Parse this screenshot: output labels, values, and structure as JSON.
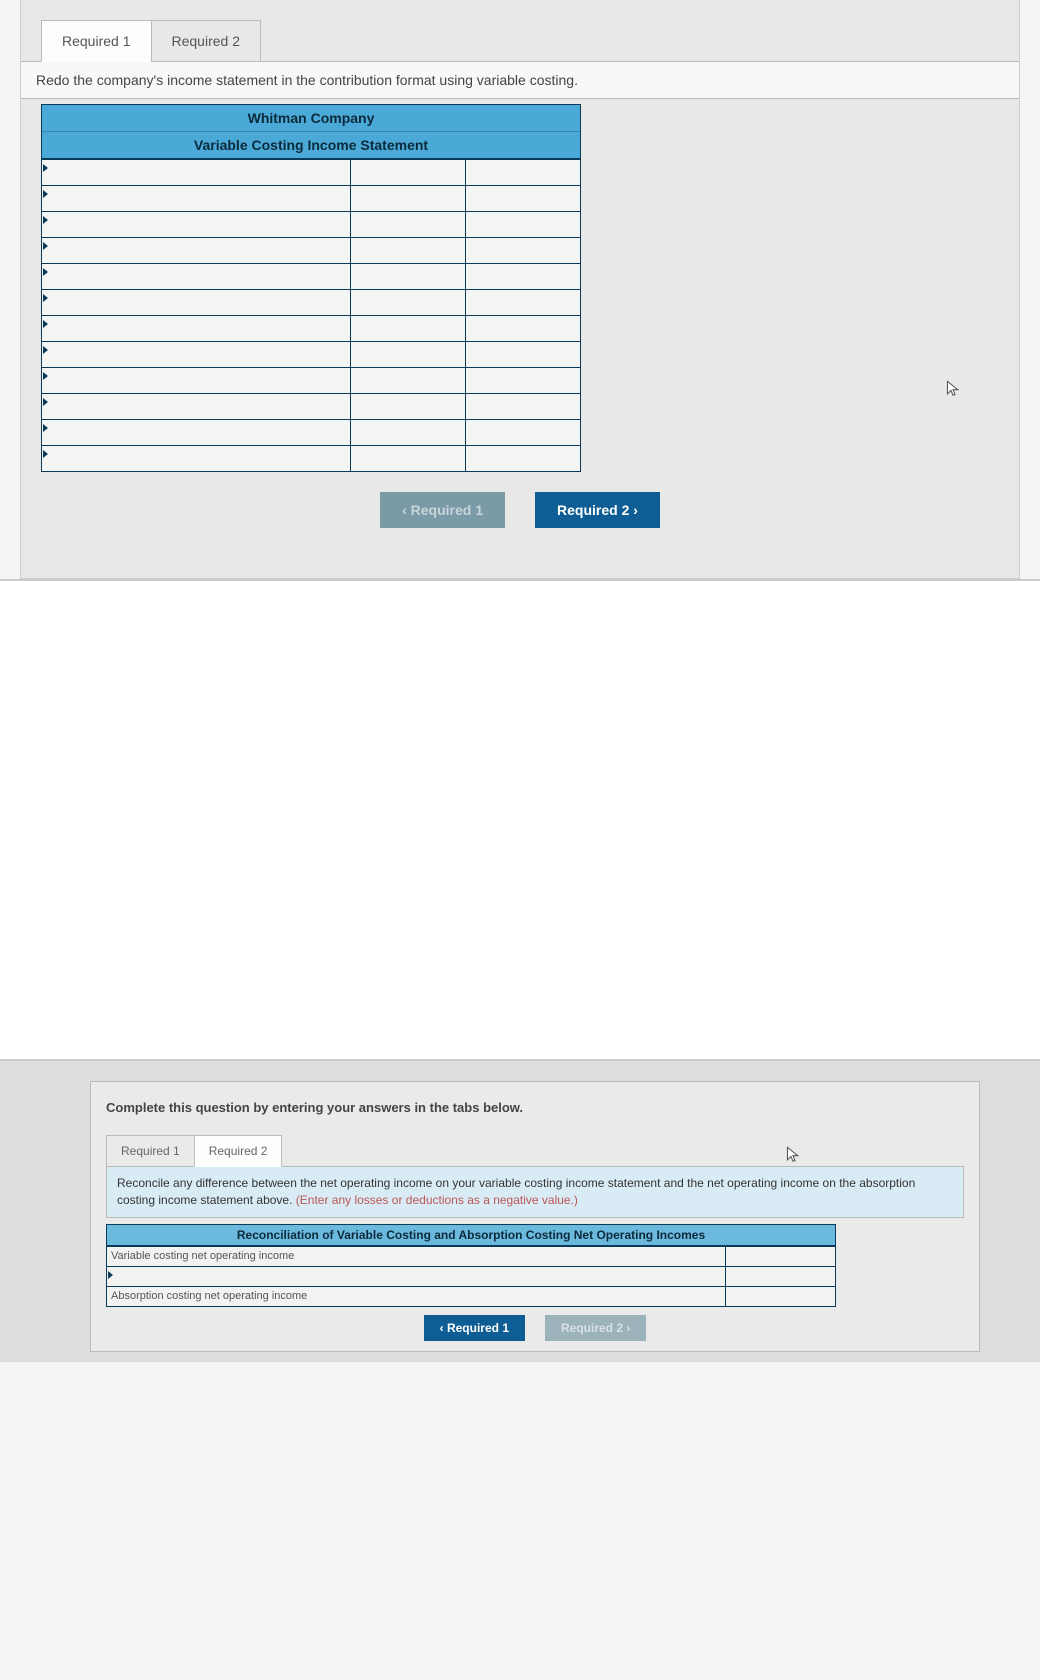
{
  "panel1": {
    "tabs": [
      "Required 1",
      "Required 2"
    ],
    "active_tab_index": 0,
    "instruction": "Redo the company's income statement in the contribution format using variable costing.",
    "table_header_lines": [
      "Whitman Company",
      "Variable Costing Income Statement"
    ],
    "row_count": 12,
    "nav_prev": "‹  Required 1",
    "nav_next": "Required 2  ›"
  },
  "panel2": {
    "intro": "Complete this question by entering your answers in the tabs below.",
    "tabs": [
      "Required 1",
      "Required 2"
    ],
    "active_tab_index": 1,
    "instruction_main": "Reconcile any difference between the net operating income on your variable costing income statement and the net operating income on the absorption costing income statement above. ",
    "instruction_hint": "(Enter any losses or deductions as a negative value.)",
    "table_header": "Reconciliation of Variable Costing and Absorption Costing Net Operating Incomes",
    "rows": [
      "Variable costing net operating income",
      "",
      "Absorption costing net operating income"
    ],
    "nav_prev": "‹  Required 1",
    "nav_next": "Required 2  ›"
  }
}
